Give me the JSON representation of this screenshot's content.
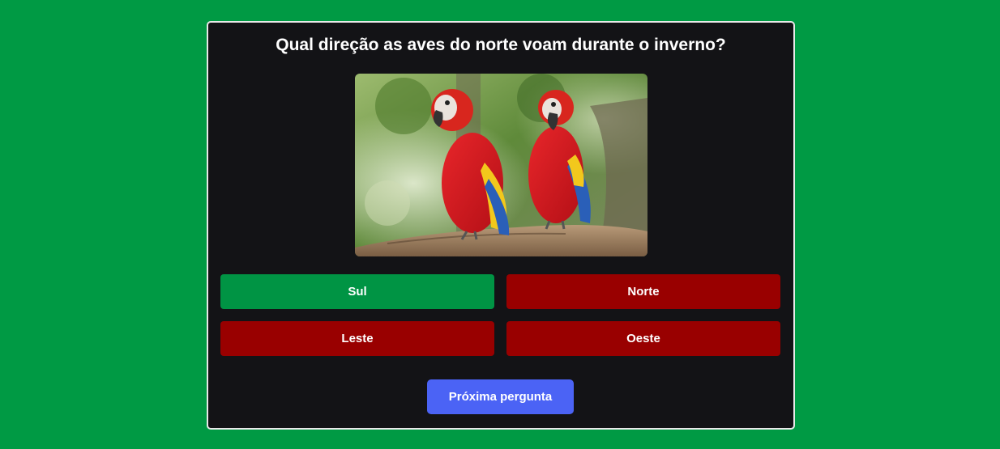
{
  "quiz": {
    "question": "Qual direção as aves do norte voam durante o inverno?",
    "image_subject": "two scarlet macaws perched on a branch",
    "answers": [
      {
        "label": "Sul",
        "state": "correct",
        "color": "#009444"
      },
      {
        "label": "Norte",
        "state": "incorrect",
        "color": "#990000"
      },
      {
        "label": "Leste",
        "state": "incorrect",
        "color": "#990000"
      },
      {
        "label": "Oeste",
        "state": "incorrect",
        "color": "#990000"
      }
    ],
    "next_label": "Próxima pergunta"
  },
  "colors": {
    "page_background": "#009a44",
    "card_background": "#131316",
    "card_border": "#e9e9e9",
    "correct": "#009444",
    "incorrect": "#990000",
    "next_button": "#4b63f5"
  }
}
